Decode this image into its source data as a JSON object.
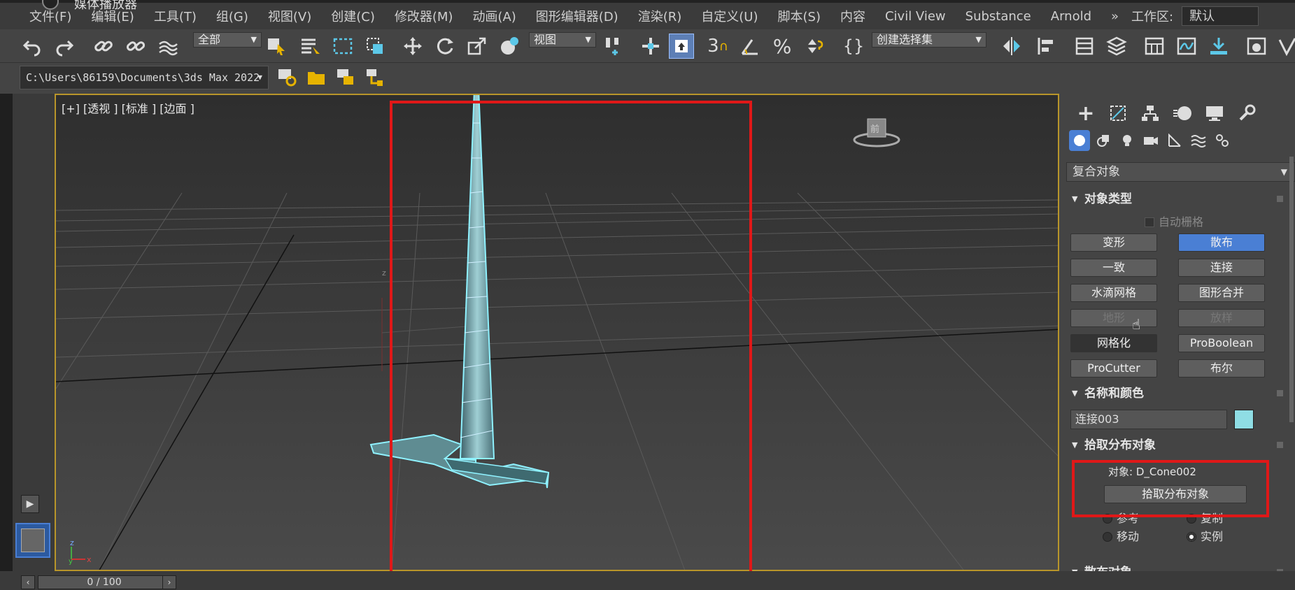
{
  "app": {
    "title": "媒体播放器"
  },
  "menu": [
    "文件(F)",
    "编辑(E)",
    "工具(T)",
    "组(G)",
    "视图(V)",
    "创建(C)",
    "修改器(M)",
    "动画(A)",
    "图形编辑器(D)",
    "渲染(R)",
    "自定义(U)",
    "脚本(S)",
    "内容",
    "Civil View",
    "Substance",
    "Arnold"
  ],
  "workspace": {
    "label": "工作区:",
    "value": "默认"
  },
  "toolbar": {
    "filter": "全部",
    "coord": "视图",
    "selection_set": "创建选择集",
    "three_label": "3"
  },
  "path": "C:\\Users\\86159\\Documents\\3ds Max 2022",
  "viewport": {
    "label": "[+] [透视 ] [标准 ] [边面 ]",
    "cube_label": "前"
  },
  "panel": {
    "category": "复合对象",
    "object_type": {
      "title": "对象类型",
      "autogrid": "自动栅格",
      "buttons": [
        {
          "label": "变形",
          "state": "normal"
        },
        {
          "label": "散布",
          "state": "active"
        },
        {
          "label": "一致",
          "state": "normal"
        },
        {
          "label": "连接",
          "state": "normal"
        },
        {
          "label": "水滴网格",
          "state": "normal"
        },
        {
          "label": "图形合并",
          "state": "normal"
        },
        {
          "label": "地形",
          "state": "disabled"
        },
        {
          "label": "放样",
          "state": "disabled"
        },
        {
          "label": "网格化",
          "state": "dark"
        },
        {
          "label": "ProBoolean",
          "state": "normal"
        },
        {
          "label": "ProCutter",
          "state": "normal"
        },
        {
          "label": "布尔",
          "state": "normal"
        }
      ]
    },
    "name_color": {
      "title": "名称和颜色",
      "name": "连接003",
      "color": "#8fdde4"
    },
    "pick": {
      "title": "拾取分布对象",
      "object_line": "对象: D_Cone002",
      "button": "拾取分布对象",
      "options": [
        "参考",
        "复制",
        "移动",
        "实例"
      ],
      "selected": "实例"
    },
    "next_rollout": "散布对象"
  },
  "timeline": {
    "frame": "0 / 100"
  }
}
